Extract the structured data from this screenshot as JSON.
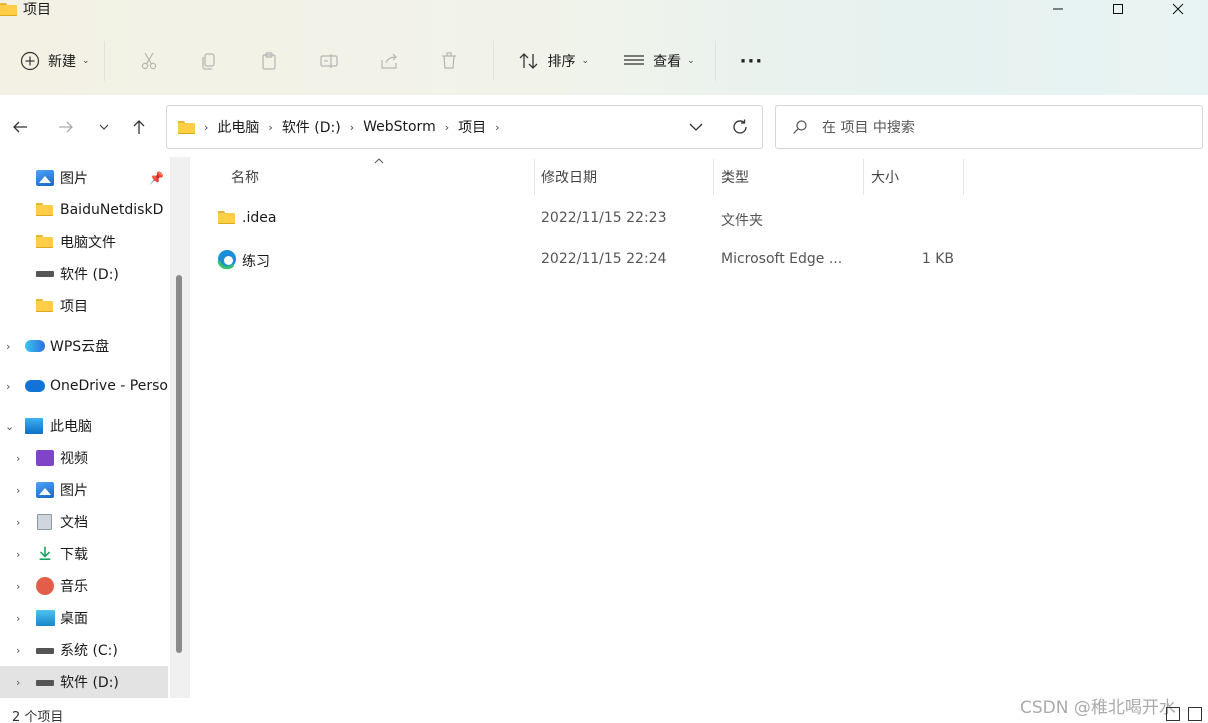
{
  "window": {
    "title": "项目",
    "minimize": "—",
    "maximize": "☐",
    "close": "✕"
  },
  "toolbar": {
    "new_label": "新建",
    "sort_label": "排序",
    "view_label": "查看",
    "more_label": "···"
  },
  "address": {
    "crumbs": [
      "此电脑",
      "软件 (D:)",
      "WebStorm",
      "项目"
    ]
  },
  "search": {
    "placeholder": "在 项目 中搜索"
  },
  "sidebar": {
    "quick_access": [
      {
        "label": "图片",
        "icon": "pictures-icon",
        "pinned": true
      },
      {
        "label": "BaiduNetdiskD",
        "icon": "folder-icon"
      },
      {
        "label": "电脑文件",
        "icon": "folder-icon"
      },
      {
        "label": "软件 (D:)",
        "icon": "drive-icon"
      },
      {
        "label": "项目",
        "icon": "folder-icon"
      }
    ],
    "roots": [
      {
        "label": "WPS云盘",
        "icon": "wps-cloud-icon"
      },
      {
        "label": "OneDrive - Perso",
        "icon": "onedrive-icon"
      },
      {
        "label": "此电脑",
        "icon": "this-pc-icon"
      }
    ],
    "this_pc": [
      {
        "label": "视频",
        "icon": "videos-icon"
      },
      {
        "label": "图片",
        "icon": "pictures-icon"
      },
      {
        "label": "文档",
        "icon": "documents-icon"
      },
      {
        "label": "下载",
        "icon": "downloads-icon"
      },
      {
        "label": "音乐",
        "icon": "music-icon"
      },
      {
        "label": "桌面",
        "icon": "desktop-icon"
      },
      {
        "label": "系统 (C:)",
        "icon": "drive-icon"
      },
      {
        "label": "软件 (D:)",
        "icon": "drive-icon",
        "selected": true
      }
    ]
  },
  "columns": {
    "name": "名称",
    "modified": "修改日期",
    "type": "类型",
    "size": "大小"
  },
  "files": [
    {
      "name": ".idea",
      "modified": "2022/11/15 22:23",
      "type": "文件夹",
      "size": "",
      "icon": "folder-icon"
    },
    {
      "name": "练习",
      "modified": "2022/11/15 22:24",
      "type": "Microsoft Edge ...",
      "size": "1 KB",
      "icon": "edge-icon"
    }
  ],
  "status": {
    "count_text": "2 个项目"
  },
  "watermark": "CSDN @稚北喝开水",
  "colors": {
    "folder": "#ffcd47",
    "selection": "#e3e3e3",
    "accent": "#0c6fc6"
  }
}
